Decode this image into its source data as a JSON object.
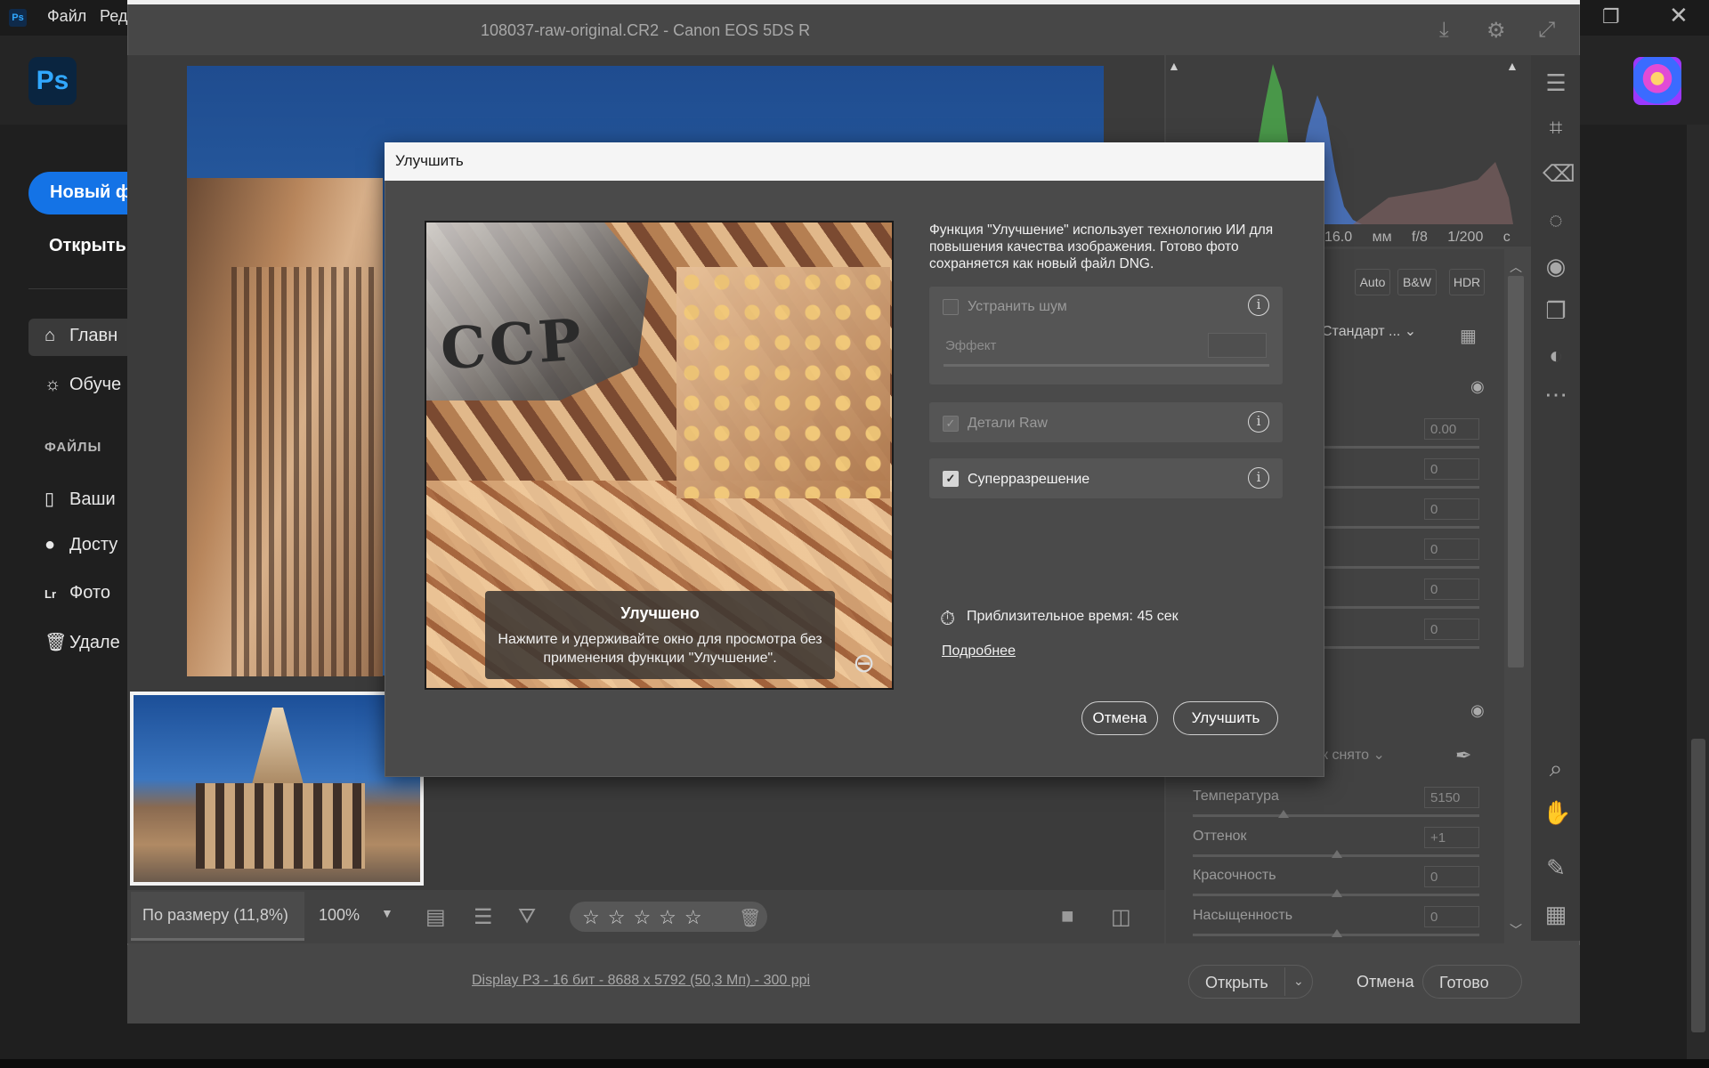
{
  "ps": {
    "menu": [
      "Файл",
      "Ред"
    ],
    "logo": "Ps",
    "new_file": "Новый фа",
    "open": "Открыть",
    "nav": [
      {
        "label": "Главн",
        "icon": "home-icon"
      },
      {
        "label": "Обуче",
        "icon": "lightbulb-icon"
      }
    ],
    "files_title": "ФАЙЛЫ",
    "files": [
      {
        "label": "Ваши",
        "icon": "document-icon"
      },
      {
        "label": "Досту",
        "icon": "user-share-icon"
      },
      {
        "label": "Фото",
        "icon": "lightroom-icon"
      },
      {
        "label": "Удале",
        "icon": "trash-icon"
      }
    ],
    "window_controls": [
      "restore-icon",
      "close-icon"
    ]
  },
  "acr": {
    "title": "108037-raw-original.CR2  -  Canon EOS 5DS R",
    "zoom_fit": "По размеру (11,8%)",
    "zoom_100": "100%",
    "rating_stars": "☆☆☆☆☆",
    "file_info": "Display P3 - 16 бит - 8688 x 5792 (50,3 Мп) - 300 ppi",
    "open_btn": "Открыть",
    "cancel_btn": "Отмена",
    "done_btn": "Готово",
    "camera_info": {
      "focal": "16.0 мм",
      "aperture": "f/8",
      "shutter": "1/200 с"
    },
    "profile_buttons": [
      "Auto",
      "B&W",
      "HDR"
    ],
    "profile_select": "Стандарт ...",
    "basic_values": [
      "0.00",
      "0",
      "0",
      "0",
      "0",
      "0"
    ],
    "wb_select": "к снято",
    "sliders": [
      {
        "label": "Температура",
        "value": "5150"
      },
      {
        "label": "Оттенок",
        "value": "+1"
      },
      {
        "label": "Красочность",
        "value": "0"
      },
      {
        "label": "Насыщенность",
        "value": "0"
      }
    ]
  },
  "dialog": {
    "title": "Улучшить",
    "description": "Функция \"Улучшение\" использует технологию ИИ для повышения качества изображения. Готово фото сохраняется как новый файл DNG.",
    "options": {
      "denoise": {
        "label": "Устранить шум",
        "checked": false,
        "enabled": false
      },
      "effect_label": "Эффект",
      "raw_details": {
        "label": "Детали Raw",
        "checked": true,
        "enabled": false
      },
      "super_resolution": {
        "label": "Суперразрешение",
        "checked": true,
        "enabled": true
      }
    },
    "preview_caption_title": "Улучшено",
    "preview_caption_text": "Нажмите и удерживайте окно для просмотра без применения функции \"Улучшение\".",
    "preview_text": "ССР",
    "estimated_time": "Приблизительное время: 45 сек",
    "more_link": "Подробнее",
    "cancel": "Отмена",
    "enhance": "Улучшить"
  },
  "colors": {
    "accent": "#1473e6",
    "dialog_title_bg": "#f5f5f5",
    "dialog_bg": "#4a4a4a"
  }
}
